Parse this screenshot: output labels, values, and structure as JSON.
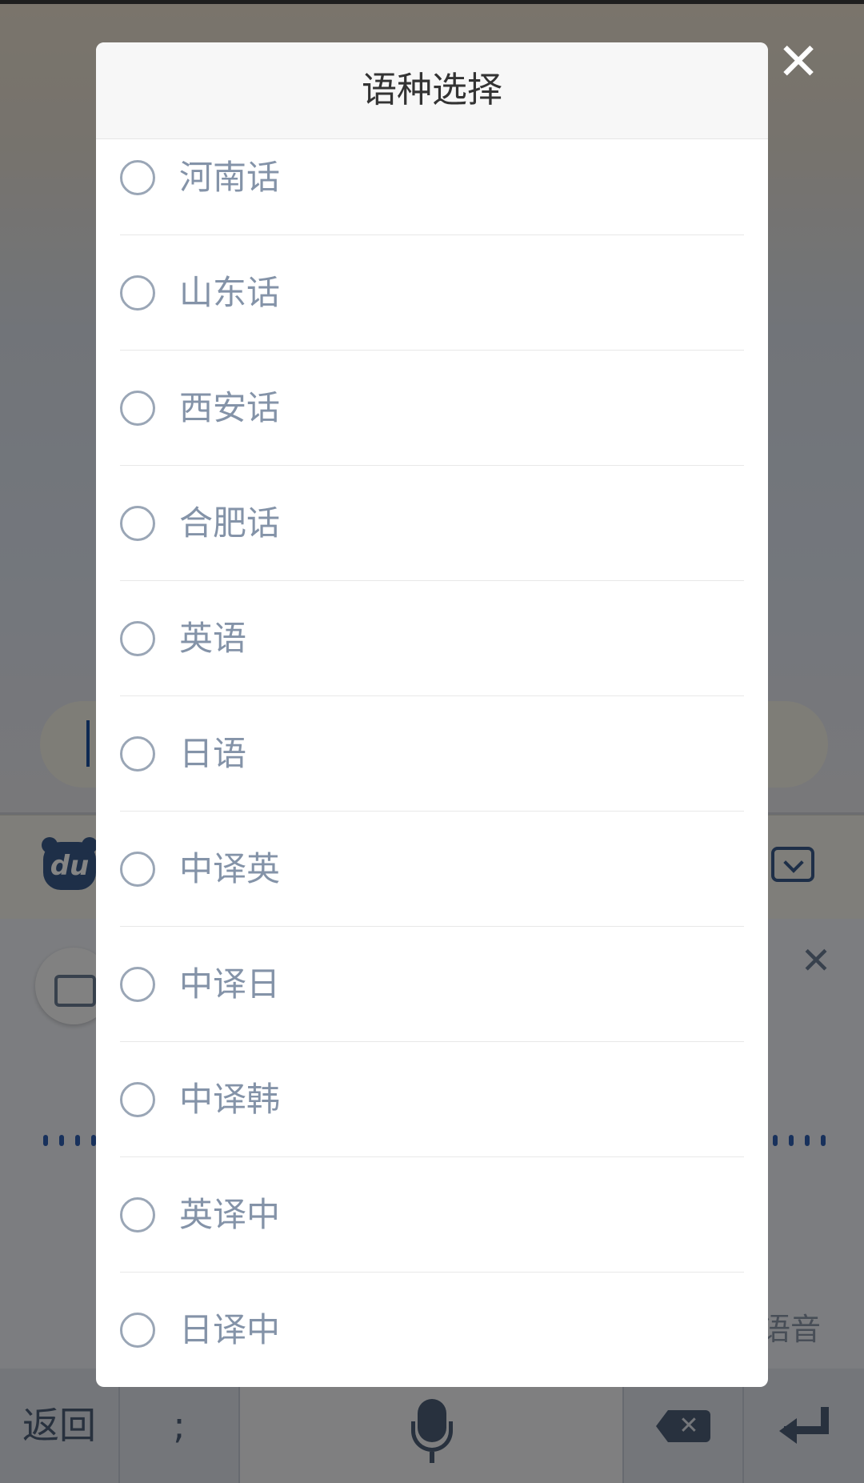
{
  "dialog": {
    "title": "语种选择",
    "close_icon": "close-icon",
    "options": [
      {
        "label": "河南话",
        "selected": false
      },
      {
        "label": "山东话",
        "selected": false
      },
      {
        "label": "西安话",
        "selected": false
      },
      {
        "label": "合肥话",
        "selected": false
      },
      {
        "label": "英语",
        "selected": false
      },
      {
        "label": "日语",
        "selected": false
      },
      {
        "label": "中译英",
        "selected": false
      },
      {
        "label": "中译日",
        "selected": false
      },
      {
        "label": "中译韩",
        "selected": false
      },
      {
        "label": "英译中",
        "selected": false
      },
      {
        "label": "日译中",
        "selected": false
      }
    ]
  },
  "background": {
    "logo_text": "du",
    "voice_hint": "语音",
    "keyboard": {
      "back_label": "返回",
      "semicolon_label": ";"
    }
  },
  "colors": {
    "scrim": "#000000",
    "radio_border": "#9aa6b6",
    "option_text": "#8493a8",
    "header_bg": "#f7f7f7"
  }
}
